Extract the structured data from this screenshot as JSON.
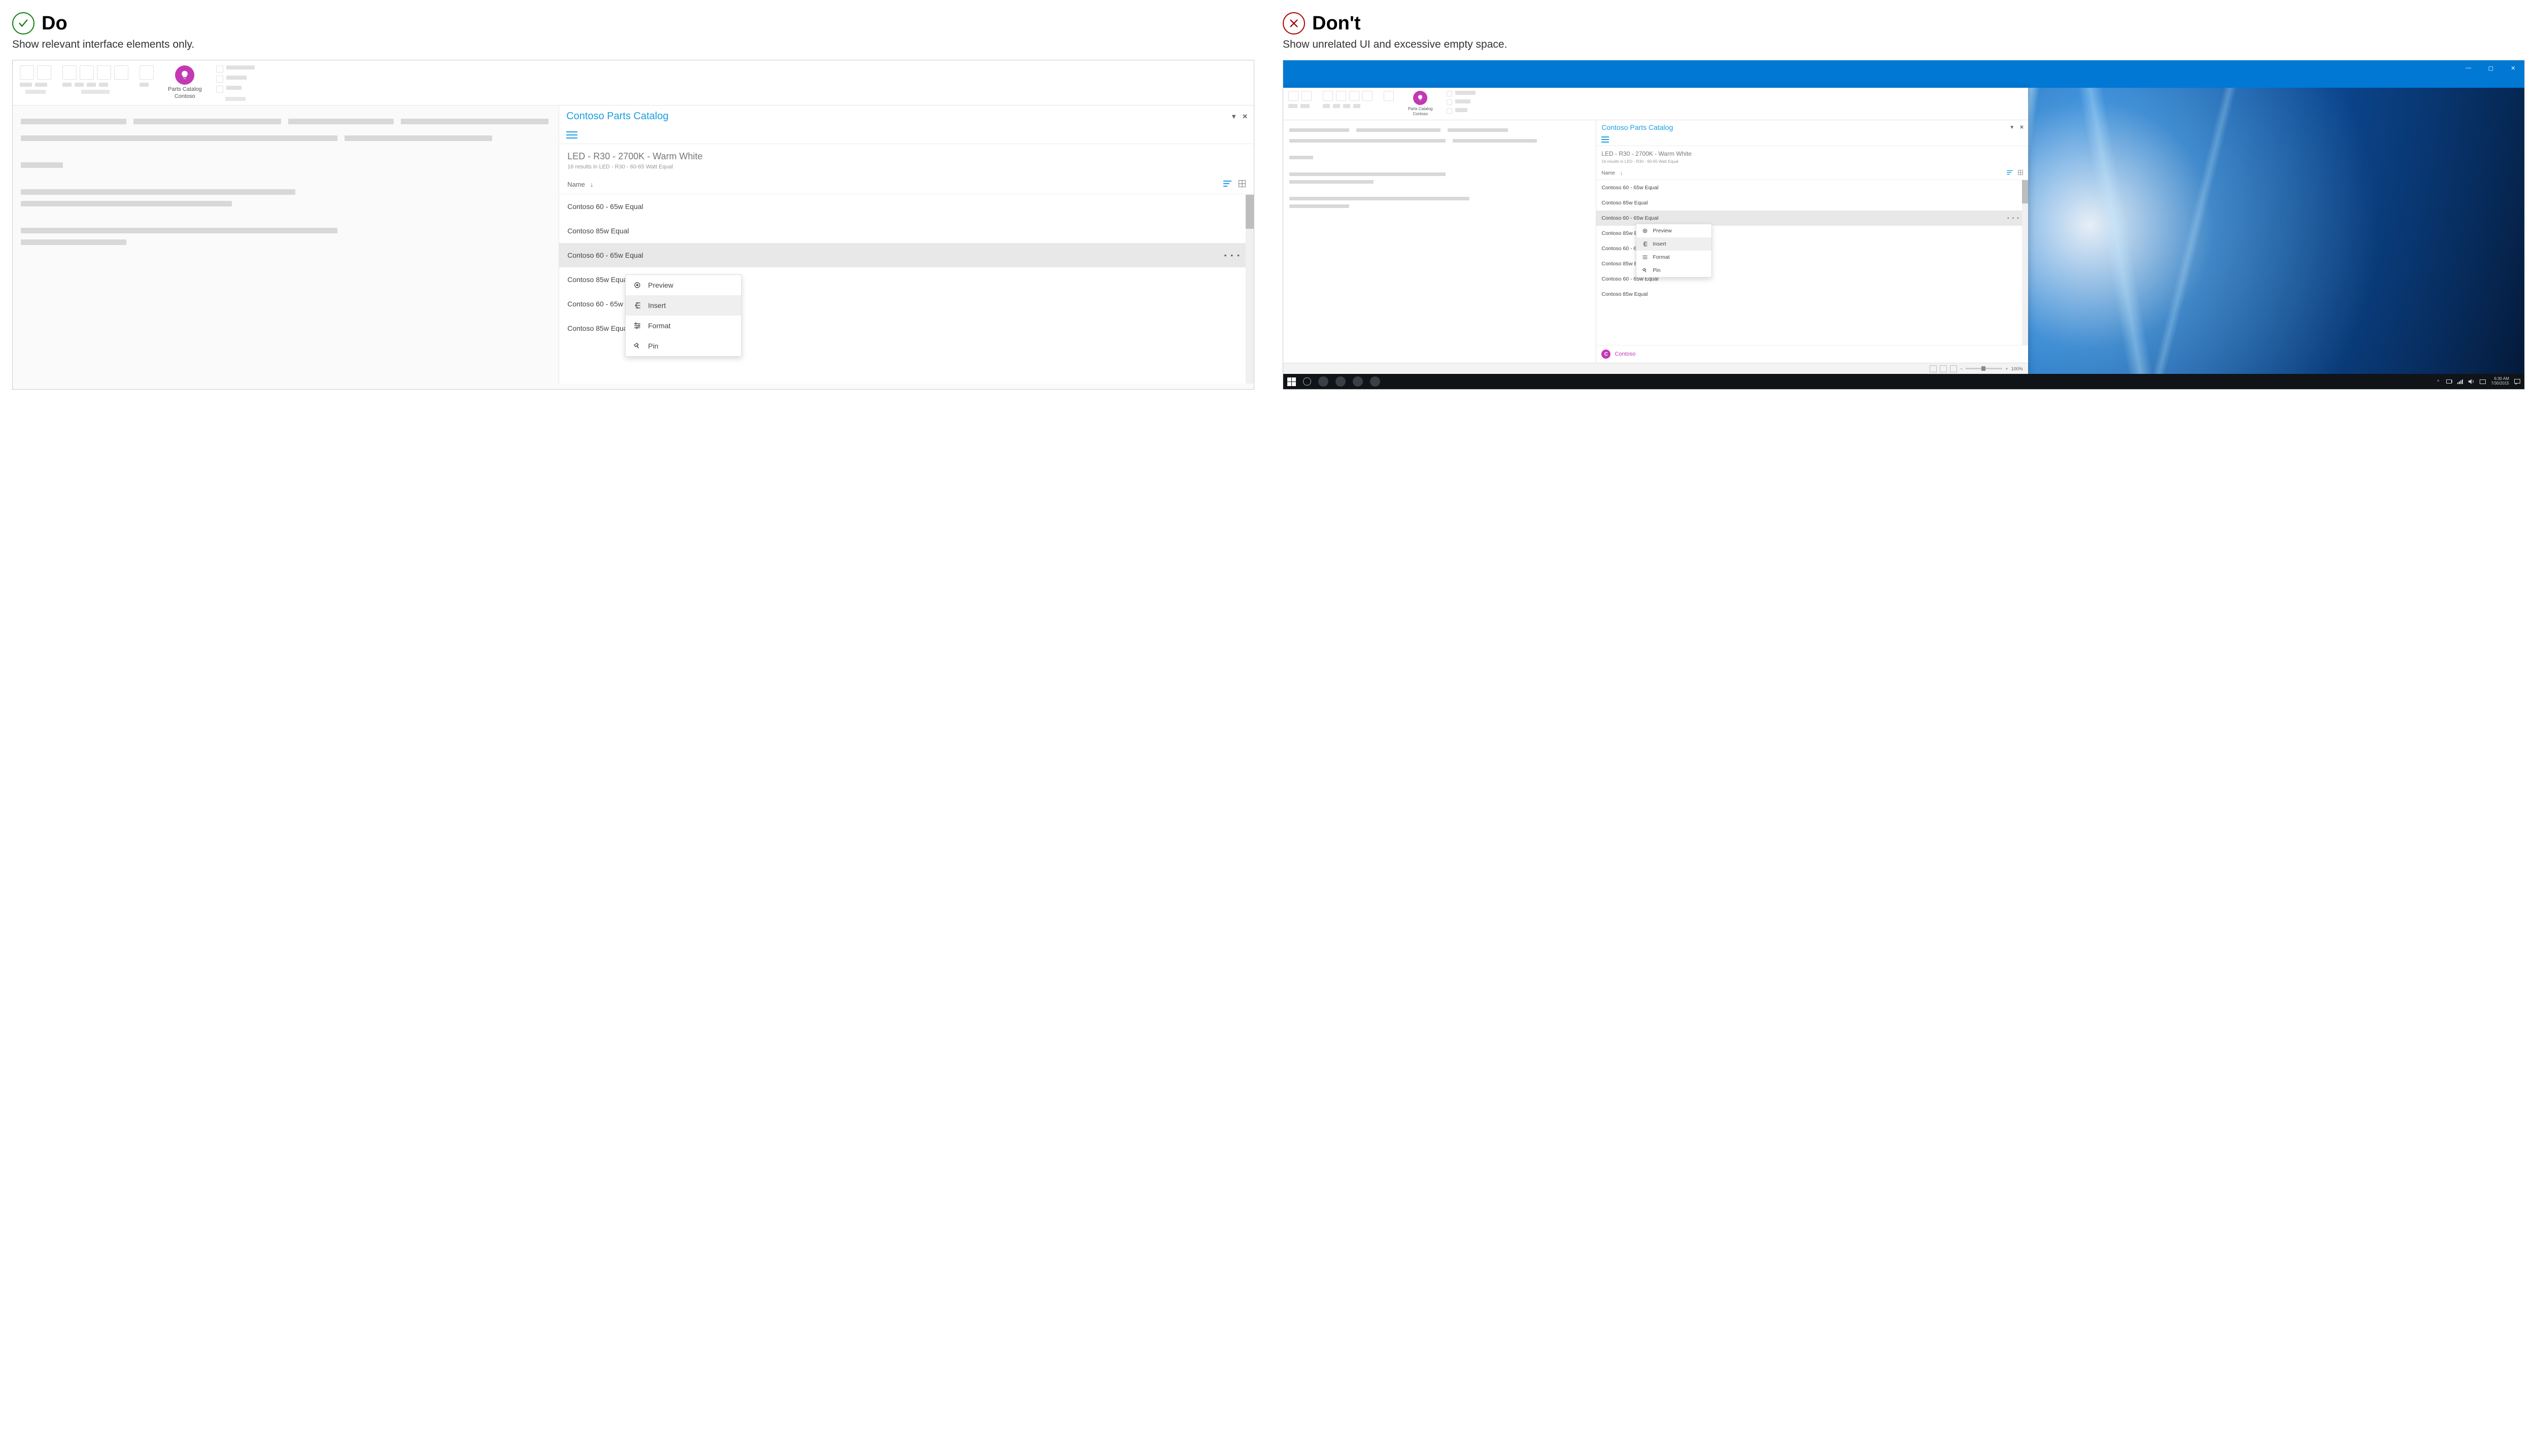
{
  "do": {
    "title": "Do",
    "sub": "Show relevant interface elements only."
  },
  "dont": {
    "title": "Don't",
    "sub": "Show unrelated UI and excessive empty space."
  },
  "ribbon": {
    "catalog_line1": "Parts Catalog",
    "catalog_line2": "Contoso"
  },
  "pane": {
    "title": "Contoso Parts Catalog",
    "crumb_main": "LED - R30 - 2700K - Warm White",
    "crumb_sub": "16 results in LED - R30 - 60-65 Watt Equal",
    "col_name": "Name",
    "items": [
      "Contoso 60 - 65w Equal",
      "Contoso 85w Equal",
      "Contoso 60 - 65w Equal",
      "Contoso 85w Equal",
      "Contoso 60 - 65w Equal",
      "Contoso 85w Equal",
      "Contoso 60 - 65w Equal",
      "Contoso 85w Equal"
    ],
    "brand": "Contoso",
    "brand_initial": "C"
  },
  "menu": {
    "preview": "Preview",
    "insert": "Insert",
    "format": "Format",
    "pin": "Pin"
  },
  "footer": {
    "zoom": "100%"
  },
  "taskbar": {
    "time": "6:30 AM",
    "date": "7/30/2015"
  }
}
